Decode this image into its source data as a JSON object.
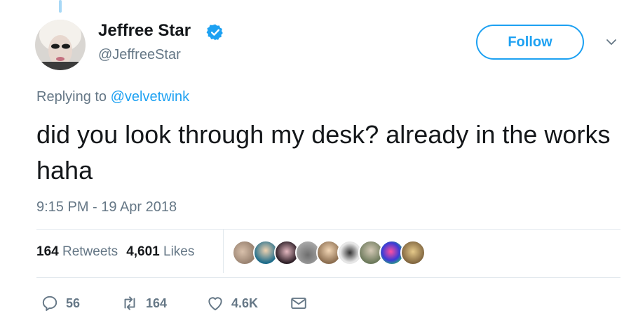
{
  "author": {
    "name": "Jeffree Star",
    "handle": "@JeffreeStar"
  },
  "follow_label": "Follow",
  "reply": {
    "prefix": "Replying to ",
    "mention": "@velvetwink"
  },
  "tweet_text": "did you look through my desk? already in the works haha",
  "timestamp": "9:15 PM - 19 Apr 2018",
  "stats": {
    "retweets_count": "164",
    "retweets_label": "Retweets",
    "likes_count": "4,601",
    "likes_label": "Likes"
  },
  "actions": {
    "reply_count": "56",
    "retweet_count": "164",
    "like_count": "4.6K"
  },
  "colors": {
    "accent": "#1da1f2",
    "muted_text": "#657786",
    "divider": "#e1e8ed"
  }
}
